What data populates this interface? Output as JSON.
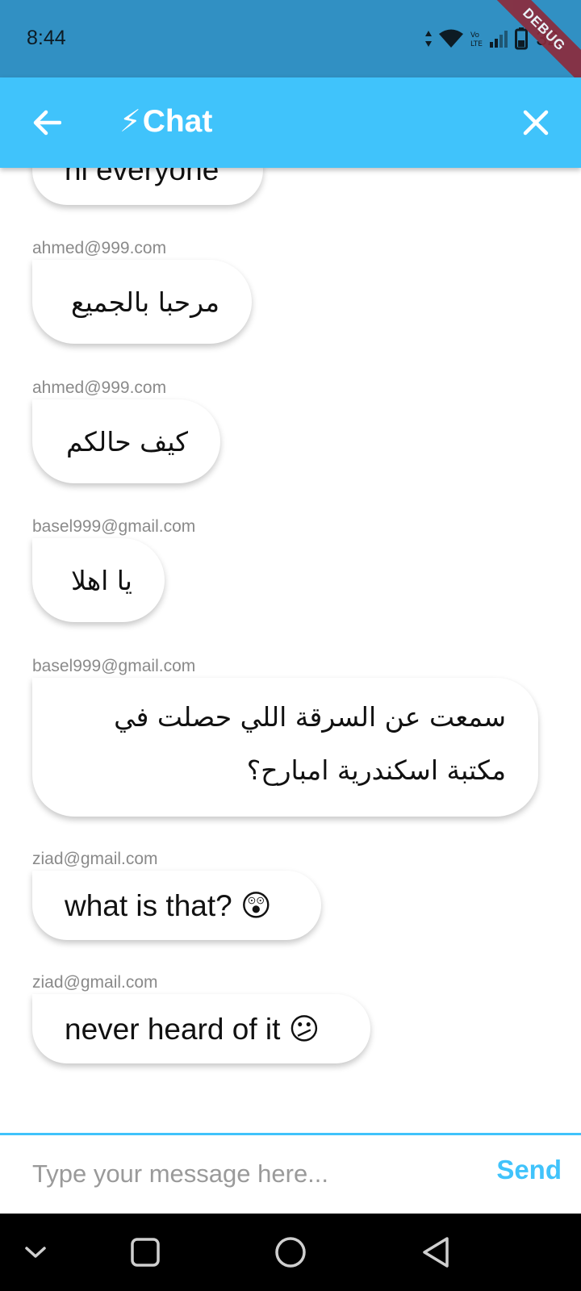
{
  "status_bar": {
    "time": "8:44",
    "battery": "32"
  },
  "debug_banner": "DEBUG",
  "app_bar": {
    "title_icon": "⚡",
    "title": "Chat",
    "back_icon": "arrow-back-icon",
    "close_icon": "close-icon"
  },
  "messages": [
    {
      "sender": "",
      "text": "hi everyone"
    },
    {
      "sender": "ahmed@999.com",
      "text": "مرحبا بالجميع"
    },
    {
      "sender": "ahmed@999.com",
      "text": "كيف حالكم"
    },
    {
      "sender": "basel999@gmail.com",
      "text": "يا اهلا"
    },
    {
      "sender": "basel999@gmail.com",
      "text": "سمعت عن السرقة اللي حصلت في مكتبة اسكندرية امبارح؟"
    },
    {
      "sender": "ziad@gmail.com",
      "text": "what is that? 😲"
    },
    {
      "sender": "ziad@gmail.com",
      "text": "never heard of it 😕"
    }
  ],
  "input": {
    "placeholder": "Type your message here...",
    "value": ""
  },
  "send_label": "Send",
  "colors": {
    "accent": "#40c3fb",
    "status_bar": "#3190c3"
  }
}
